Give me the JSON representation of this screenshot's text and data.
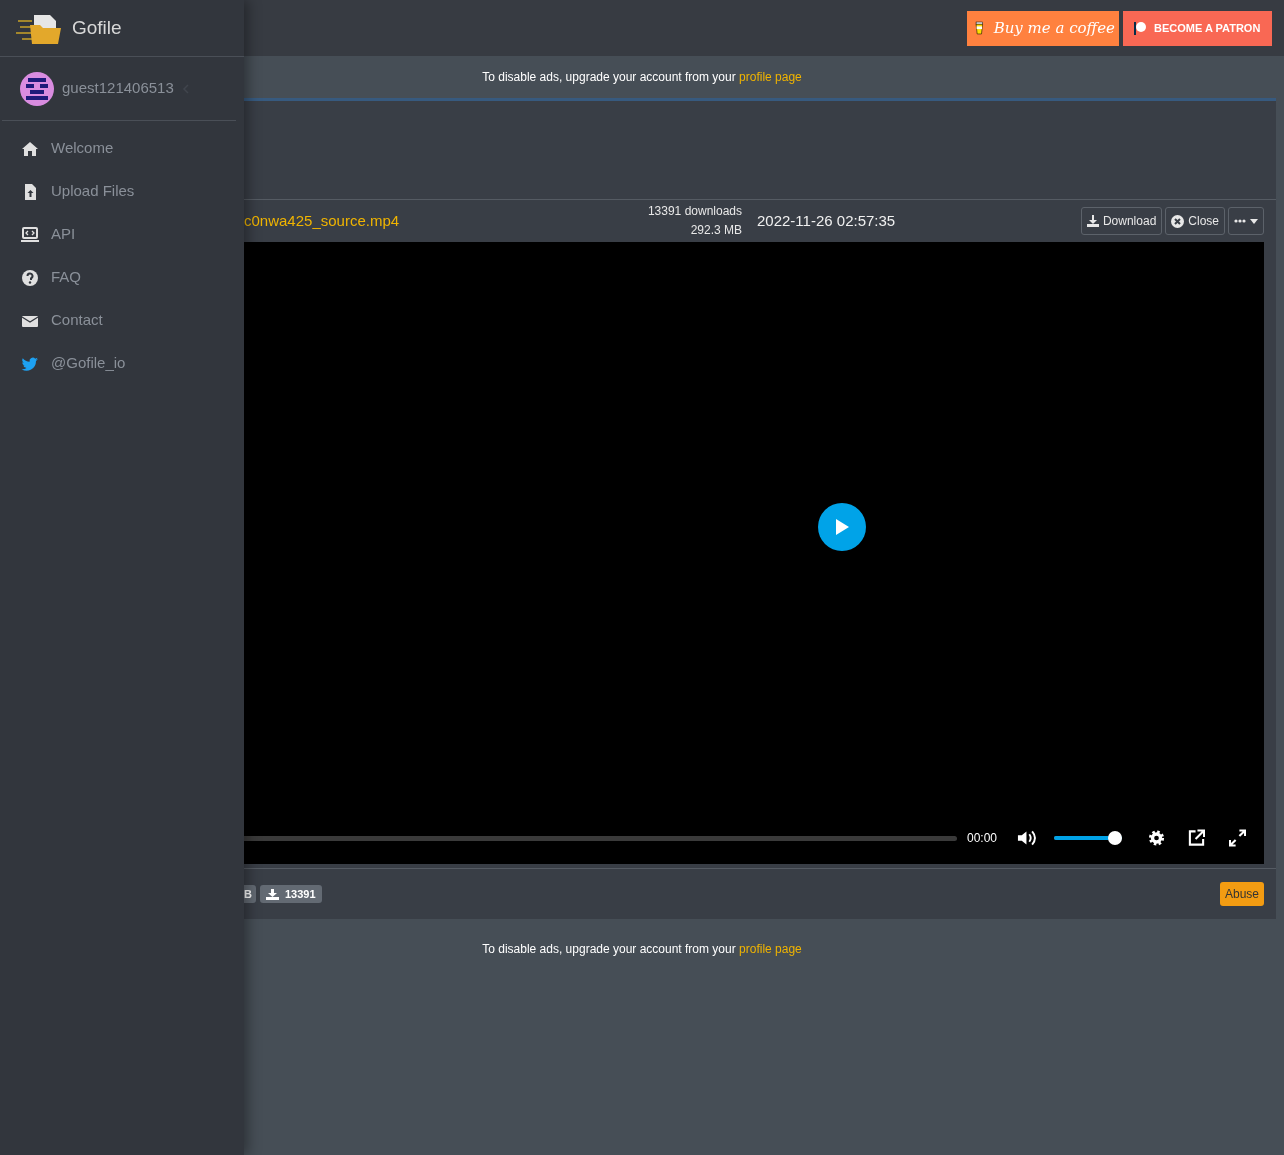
{
  "brand": {
    "name": "Gofile"
  },
  "sponsors": [
    {
      "kind": "coffee",
      "label": "Buy me a coffee"
    },
    {
      "kind": "patreon",
      "label": "BECOME A PATRON"
    }
  ],
  "user": {
    "name": "guest121406513"
  },
  "nav": [
    {
      "kind": "home",
      "label": "Welcome"
    },
    {
      "kind": "upload",
      "label": "Upload Files"
    },
    {
      "kind": "api",
      "label": "API"
    },
    {
      "kind": "faq",
      "label": "FAQ"
    },
    {
      "kind": "contact",
      "label": "Contact"
    },
    {
      "kind": "twitter",
      "label": "@Gofile_io"
    }
  ],
  "ad_notices": [
    {
      "text": "To disable ads, upgrade your account from your",
      "link": "profile page"
    },
    {
      "text": "To disable ads, upgrade your account from your",
      "link": "profile page"
    }
  ],
  "file": {
    "name": "c0nwa425_source.mp4",
    "downloads": "13391 downloads",
    "size": "292.3 MB",
    "date": "2022-11-26 02:57:35",
    "actions": [
      {
        "kind": "download",
        "label": "Download"
      },
      {
        "kind": "close",
        "label": "Close"
      },
      {
        "kind": "more"
      }
    ]
  },
  "player": {
    "progress": {
      "level": 0
    },
    "time": "00:00",
    "volume": {
      "level": 1
    }
  },
  "badges": [
    {
      "kind": "size",
      "text": "B"
    },
    {
      "kind": "downloads",
      "text": "13391"
    }
  ],
  "abuse": "Abuse"
}
